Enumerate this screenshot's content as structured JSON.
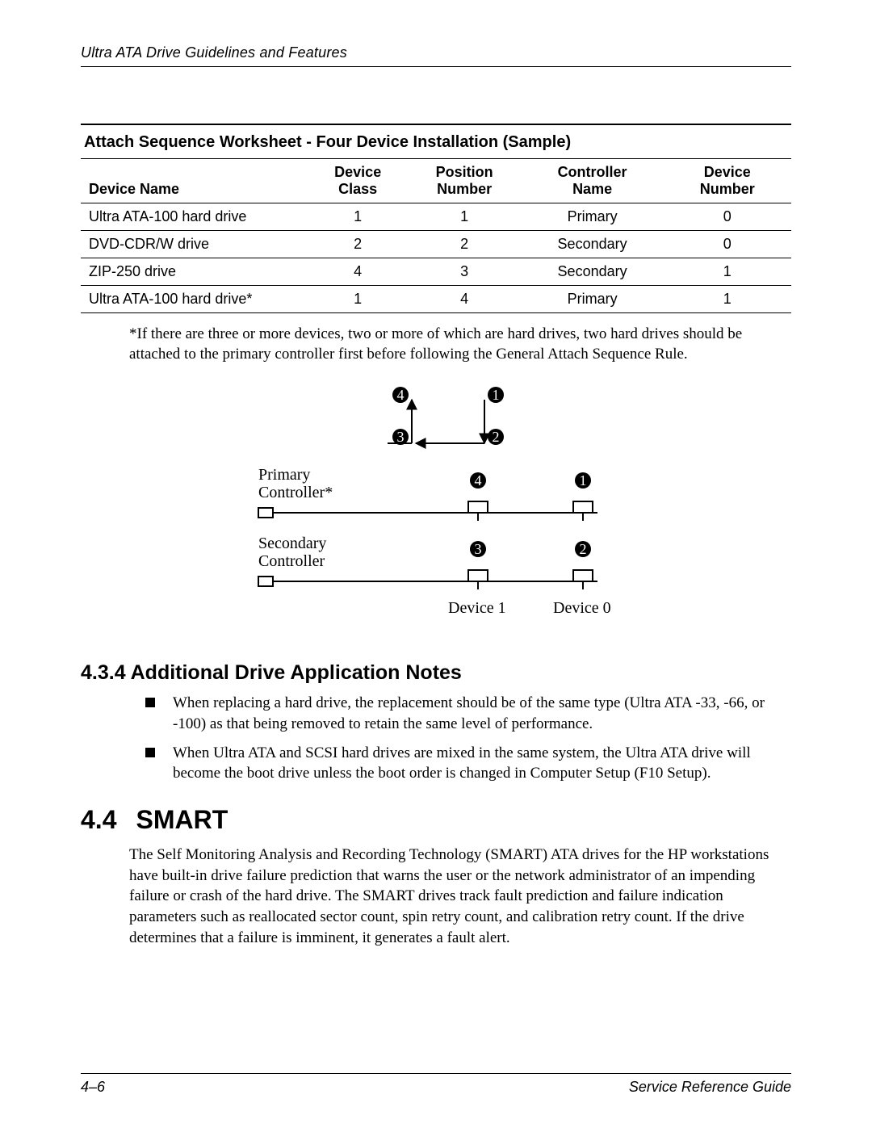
{
  "header": {
    "running_title": "Ultra ATA Drive Guidelines and Features"
  },
  "worksheet": {
    "title": "Attach Sequence Worksheet - Four Device Installation (Sample)",
    "columns": {
      "c0": "Device Name",
      "c1_a": "Device",
      "c1_b": "Class",
      "c2_a": "Position",
      "c2_b": "Number",
      "c3_a": "Controller",
      "c3_b": "Name",
      "c4_a": "Device",
      "c4_b": "Number"
    },
    "rows": [
      {
        "name": "Ultra ATA-100 hard drive",
        "class": "1",
        "pos": "1",
        "ctrl": "Primary",
        "dev": "0"
      },
      {
        "name": "DVD-CDR/W drive",
        "class": "2",
        "pos": "2",
        "ctrl": "Secondary",
        "dev": "0"
      },
      {
        "name": "ZIP-250 drive",
        "class": "4",
        "pos": "3",
        "ctrl": "Secondary",
        "dev": "1"
      },
      {
        "name": "Ultra ATA-100 hard drive*",
        "class": "1",
        "pos": "4",
        "ctrl": "Primary",
        "dev": "1"
      }
    ],
    "footnote": "*If there are three or more devices, two or more of which are hard drives, two hard drives should be attached to the primary controller first before following the General Attach Sequence Rule."
  },
  "diagram": {
    "primary_label_a": "Primary",
    "primary_label_b": "Controller*",
    "secondary_label_a": "Secondary",
    "secondary_label_b": "Controller",
    "device1": "Device 1",
    "device0": "Device 0",
    "n1": "1",
    "n2": "2",
    "n3": "3",
    "n4": "4"
  },
  "section_434": {
    "heading": "4.3.4 Additional Drive Application Notes",
    "bullets": [
      "When replacing a hard drive, the replacement should be of the same type (Ultra ATA -33, -66, or -100) as that being removed to retain the same level of performance.",
      "When Ultra ATA and SCSI hard drives are mixed in the same system, the Ultra ATA drive will become the boot drive unless the boot order is changed in Computer Setup (F10 Setup)."
    ]
  },
  "section_44": {
    "num": "4.4",
    "title": "SMART",
    "body": "The Self Monitoring Analysis and Recording Technology (SMART) ATA drives for the HP workstations have built-in drive failure prediction that warns the user or the network administrator of an impending failure or crash of the hard drive. The SMART drives track fault prediction and failure indication parameters such as reallocated sector count, spin retry count, and calibration retry count. If the drive determines that a failure is imminent, it generates a fault alert."
  },
  "footer": {
    "page_num": "4–6",
    "guide": "Service Reference Guide"
  }
}
